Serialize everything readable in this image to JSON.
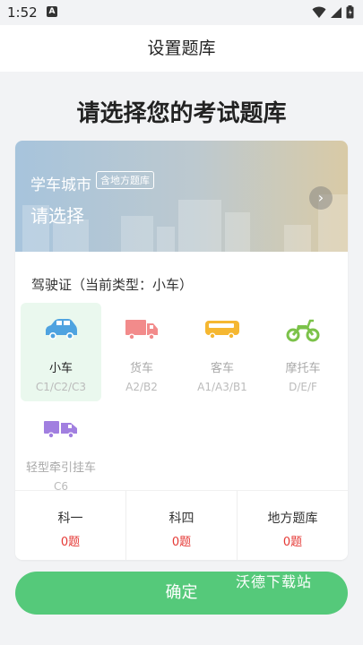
{
  "status_bar": {
    "time": "1:52",
    "notif": "A"
  },
  "header": {
    "title": "设置题库"
  },
  "page_title": "请选择您的考试题库",
  "banner": {
    "city": "学车城市",
    "tag": "含地方题库",
    "select": "请选择"
  },
  "section_label": "驾驶证（当前类型：小车）",
  "vehicles": [
    {
      "name": "小车",
      "code": "C1/C2/C3",
      "color": "#4fa3e0",
      "icon": "car-icon"
    },
    {
      "name": "货车",
      "code": "A2/B2",
      "color": "#f28b8b",
      "icon": "truck-icon"
    },
    {
      "name": "客车",
      "code": "A1/A3/B1",
      "color": "#f5b731",
      "icon": "bus-icon"
    },
    {
      "name": "摩托车",
      "code": "D/E/F",
      "color": "#7cc24a",
      "icon": "motorcycle-icon"
    },
    {
      "name": "轻型牵引挂车",
      "code": "C6",
      "color": "#a17fe0",
      "icon": "trailer-truck-icon"
    }
  ],
  "subjects": [
    {
      "name": "科一",
      "count": "0题"
    },
    {
      "name": "科四",
      "count": "0题"
    },
    {
      "name": "地方题库",
      "count": "0题"
    }
  ],
  "confirm": "确定",
  "watermark": "沃德下载站",
  "colors": {
    "accent": "#55c97a",
    "count_red": "#e53935"
  }
}
